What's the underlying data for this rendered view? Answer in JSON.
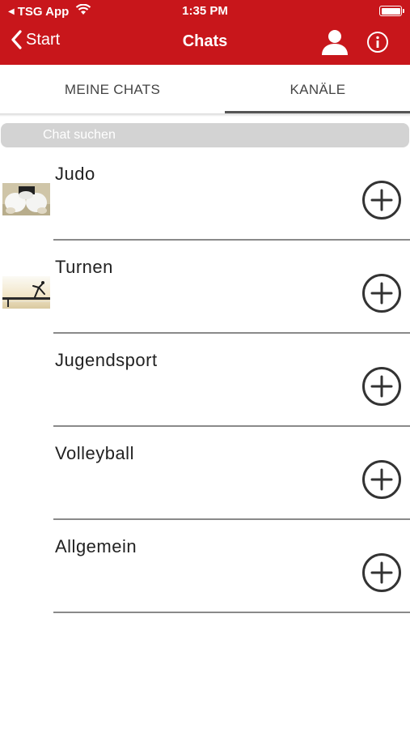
{
  "status_bar": {
    "back_app": "TSG App",
    "time": "1:35 PM"
  },
  "nav": {
    "back_label": "Start",
    "title": "Chats",
    "icons": [
      "chevron-left-icon",
      "profile-icon",
      "info-icon"
    ]
  },
  "tabs": [
    {
      "label": "MEINE CHATS",
      "selected": false
    },
    {
      "label": "KANÄLE",
      "selected": true
    }
  ],
  "search": {
    "placeholder": "Chat suchen",
    "value": ""
  },
  "channels": [
    {
      "name": "Judo",
      "thumbnail": "judo-photo"
    },
    {
      "name": "Turnen",
      "thumbnail": "gymnastics-photo"
    },
    {
      "name": "Jugendsport",
      "thumbnail": null
    },
    {
      "name": "Volleyball",
      "thumbnail": null
    },
    {
      "name": "Allgemein",
      "thumbnail": null
    }
  ],
  "colors": {
    "brand_red": "#c8161b",
    "search_bg": "#d3d3d3",
    "divider": "#8a8a8a",
    "tab_indicator": "#555555"
  }
}
